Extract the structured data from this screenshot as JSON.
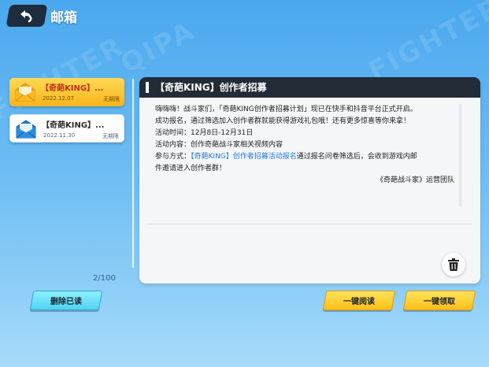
{
  "header": {
    "title": "邮箱"
  },
  "mails": [
    {
      "subject": "【奇葩KING】...",
      "date": "2022.12.07",
      "expire": "无期限",
      "selected": true
    },
    {
      "subject": "【奇葩KING】...",
      "date": "2022.11.30",
      "expire": "无期限",
      "selected": false
    }
  ],
  "list": {
    "count": "2/100"
  },
  "detail": {
    "title": "【奇葩KING】创作者招募",
    "lines": [
      "嗨嗨嗨！战斗家们，「奇葩KING创作者招募计划」现已在快手和抖音平台正式开启。",
      "成功报名，通过筛选加入创作者群就能获得游戏礼包哦！还有更多惊喜等你来拿！",
      "活动时间：12月8日-12月31日",
      "活动内容：创作奇葩战斗家相关视频内容"
    ],
    "participate_prefix": "参与方式：",
    "participate_link": "【奇葩KING】创作者招募活动报名",
    "participate_suffix": "通过报名问卷筛选后，会收到游戏内邮",
    "participate_cont": "件邀请进入创作者群！",
    "signature": "《奇葩战斗家》运营团队"
  },
  "buttons": {
    "delete_read": "删除已读",
    "read_all": "一键阅读",
    "claim_all": "一键领取"
  },
  "colors": {
    "background": "#6cbcf3",
    "selected_item": "#f7b51c",
    "header_dark": "#222b36",
    "link": "#1e7be0"
  },
  "icons": [
    "back-arrow-icon",
    "envelope-icon",
    "trash-icon"
  ]
}
